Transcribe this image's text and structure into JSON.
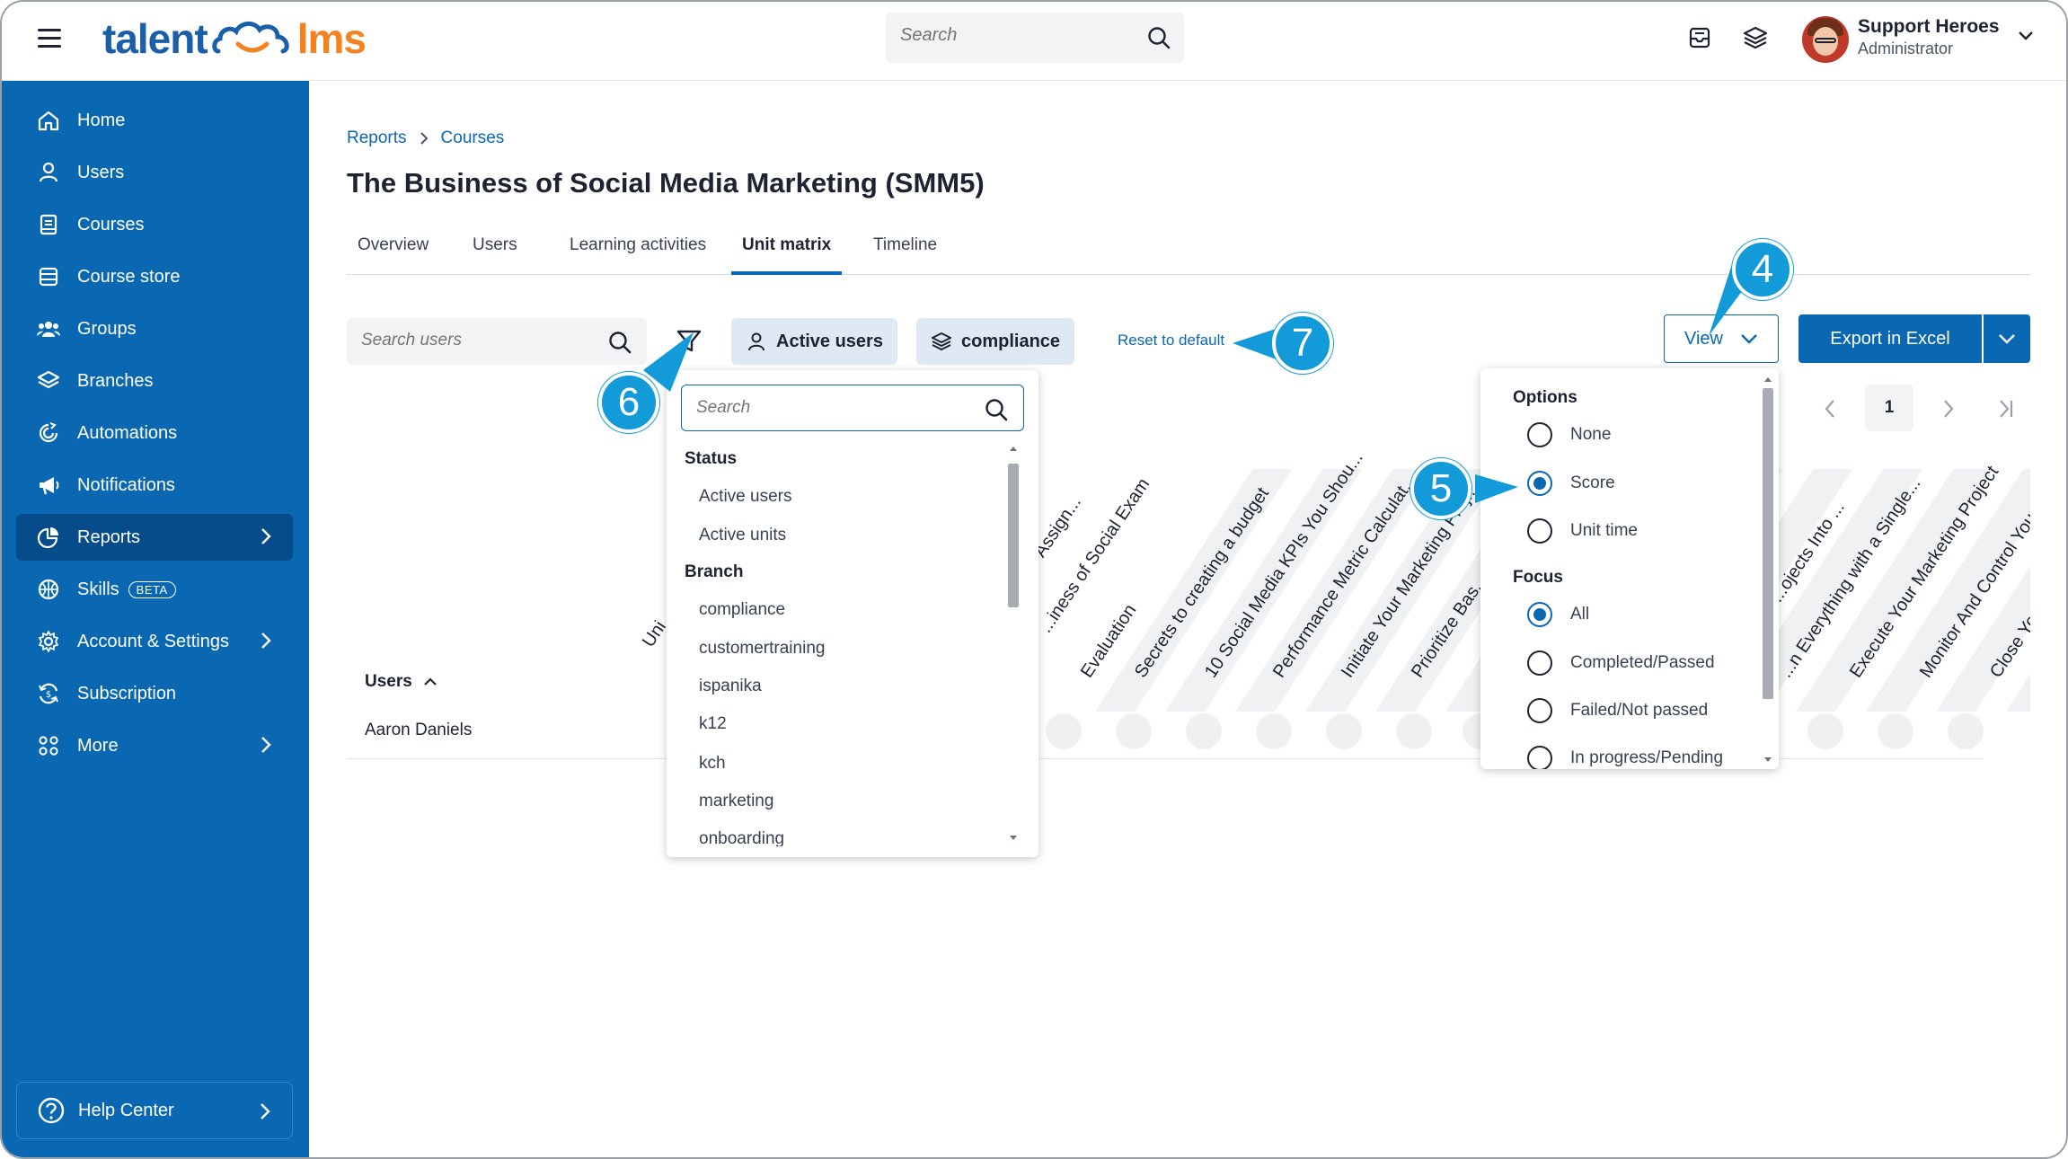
{
  "header": {
    "logo_left": "talent",
    "logo_right": "lms",
    "search_placeholder": "Search",
    "user_name": "Support Heroes",
    "user_role": "Administrator"
  },
  "sidebar": {
    "items": [
      {
        "label": "Home",
        "icon": "home-icon"
      },
      {
        "label": "Users",
        "icon": "user-icon"
      },
      {
        "label": "Courses",
        "icon": "book-icon"
      },
      {
        "label": "Course store",
        "icon": "store-icon"
      },
      {
        "label": "Groups",
        "icon": "groups-icon"
      },
      {
        "label": "Branches",
        "icon": "layers-icon"
      },
      {
        "label": "Automations",
        "icon": "automation-icon"
      },
      {
        "label": "Notifications",
        "icon": "megaphone-icon"
      },
      {
        "label": "Reports",
        "icon": "pie-chart-icon"
      },
      {
        "label": "Skills",
        "icon": "skills-icon",
        "badge": "BETA"
      },
      {
        "label": "Account & Settings",
        "icon": "gear-icon"
      },
      {
        "label": "Subscription",
        "icon": "subscription-icon"
      },
      {
        "label": "More",
        "icon": "grid-icon"
      }
    ],
    "help": "Help Center"
  },
  "breadcrumb": {
    "first": "Reports",
    "second": "Courses"
  },
  "page_title": "The Business of Social Media Marketing (SMM5)",
  "tabs": [
    "Overview",
    "Users",
    "Learning activities",
    "Unit matrix",
    "Timeline"
  ],
  "toolbar": {
    "search_placeholder": "Search users",
    "chip_active_users": "Active users",
    "chip_branch": "compliance",
    "reset": "Reset to default",
    "view": "View",
    "export": "Export in Excel"
  },
  "pagination": {
    "current": "1"
  },
  "callouts": {
    "four": "4",
    "five": "5",
    "six": "6",
    "seven": "7"
  },
  "matrix": {
    "columns": [
      "Uni",
      "Assign...",
      "...iness of Social Exam",
      "Evaluation",
      "Secrets to creating a budget",
      "10 Social Media KPIs You Shou...",
      "Performance Metric Calculat...",
      "Initiate Your Marketing Proj...",
      "Prioritize Bas...",
      "...ojects Into ...",
      "...n Everything with a Single...",
      "Execute Your Marketing Project",
      "Monitor And Control Your M...",
      "Close Your M..."
    ],
    "users_header": "Users",
    "rows": [
      {
        "name": "Aaron Daniels"
      }
    ]
  },
  "filter_menu": {
    "search_placeholder": "Search",
    "status_label": "Status",
    "status_items": [
      "Active users",
      "Active units"
    ],
    "branch_label": "Branch",
    "branch_items": [
      "compliance",
      "customertraining",
      "ispanika",
      "k12",
      "kch",
      "marketing",
      "onboarding"
    ]
  },
  "view_menu": {
    "options_label": "Options",
    "options": [
      {
        "label": "None",
        "selected": false
      },
      {
        "label": "Score",
        "selected": true
      },
      {
        "label": "Unit time",
        "selected": false
      }
    ],
    "focus_label": "Focus",
    "focus": [
      {
        "label": "All",
        "selected": true
      },
      {
        "label": "Completed/Passed",
        "selected": false
      },
      {
        "label": "Failed/Not passed",
        "selected": false
      },
      {
        "label": "In progress/Pending",
        "selected": false
      }
    ]
  },
  "colors": {
    "brand_blue": "#0a67b2",
    "callout_blue": "#139ad8",
    "logo_orange": "#f58220"
  }
}
